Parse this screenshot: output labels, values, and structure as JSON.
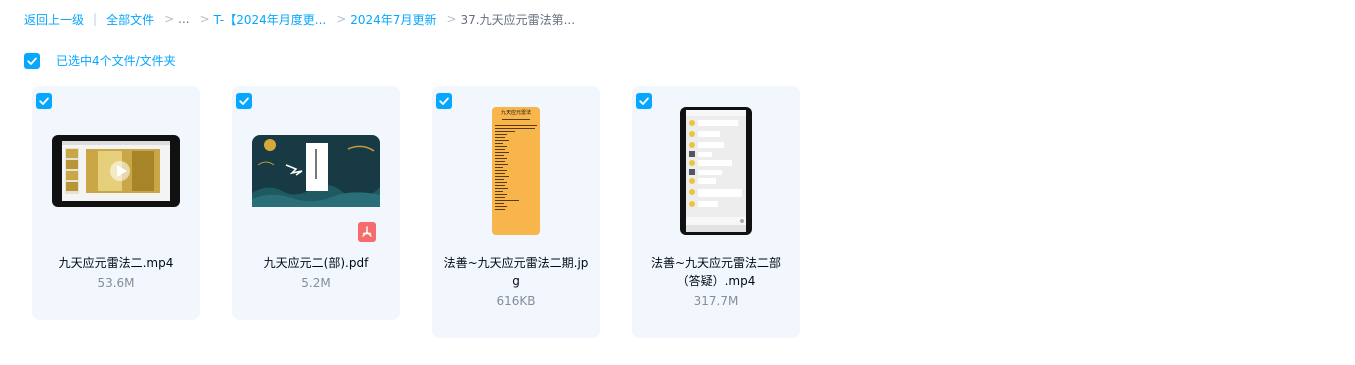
{
  "breadcrumb": {
    "back": "返回上一级",
    "all_files": "全部文件",
    "ellipsis": "...",
    "folder1": "T-【2024年月度更...",
    "folder2": "2024年7月更新",
    "current": "37.九天应元雷法第..."
  },
  "selection": {
    "label": "已选中4个文件/文件夹"
  },
  "files": [
    {
      "name": "九天应元雷法二.mp4",
      "size": "53.6M",
      "type": "video"
    },
    {
      "name": "九天应元二(部).pdf",
      "size": "5.2M",
      "type": "pdf"
    },
    {
      "name": "法善~九天应元雷法二期.jpg",
      "size": "616KB",
      "type": "image"
    },
    {
      "name": "法善~九天应元雷法二部（答疑）.mp4",
      "size": "317.7M",
      "type": "video"
    }
  ],
  "colors": {
    "accent": "#06a7ff",
    "card_bg": "#f1f7fc",
    "pdf_badge": "#f56c6c",
    "jpg_bg": "#f7b54b"
  },
  "thumb_text": {
    "jpg_title": "九天应元雷法"
  }
}
